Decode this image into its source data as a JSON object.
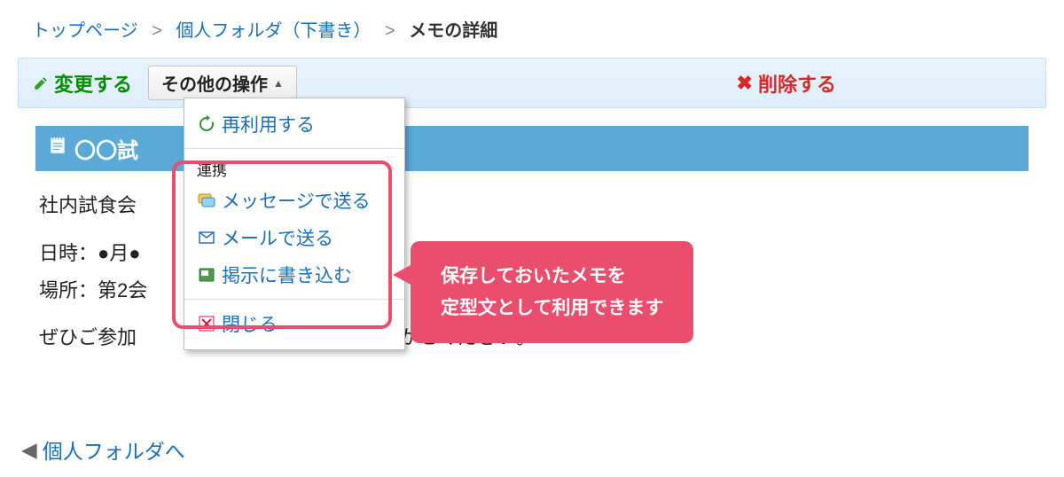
{
  "breadcrumb": {
    "top": "トップページ",
    "folder": "個人フォルダ（下書き）",
    "current": "メモの詳細"
  },
  "toolbar": {
    "edit": "変更する",
    "other_ops": "その他の操作",
    "delete": "削除する"
  },
  "dropdown": {
    "reuse": "再利用する",
    "section": "連携",
    "send_message": "メッセージで送る",
    "send_mail": "メールで送る",
    "post_bulletin": "掲示に書き込む",
    "close": "閉じる"
  },
  "memo": {
    "title": "〇〇試",
    "line1": "社内試食会",
    "line2a": "日時：●月●",
    "line2b": "場所：第2会",
    "line3": "ぜひご参加",
    "line3b": "をお聞かせください。"
  },
  "callout": {
    "line1": "保存しておいたメモを",
    "line2": "定型文として利用できます"
  },
  "back": "個人フォルダへ"
}
